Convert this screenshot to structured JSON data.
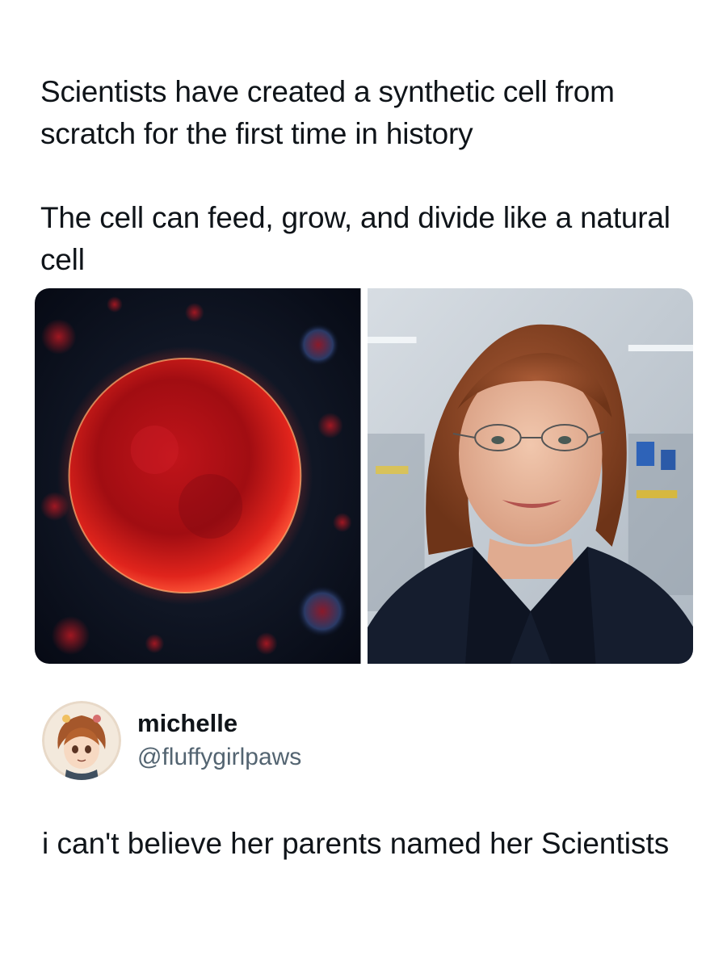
{
  "post": {
    "line1": "Scientists have created a synthetic cell from scratch for the first time in history",
    "line2": "The cell can feed, grow, and divide like a natural cell"
  },
  "media": {
    "left_image": "glowing-red-cell-image",
    "right_image": "scientist-portrait-image"
  },
  "reply": {
    "display_name": "michelle",
    "handle": "@fluffygirlpaws",
    "text": "i can't believe her parents named her Scientists"
  }
}
